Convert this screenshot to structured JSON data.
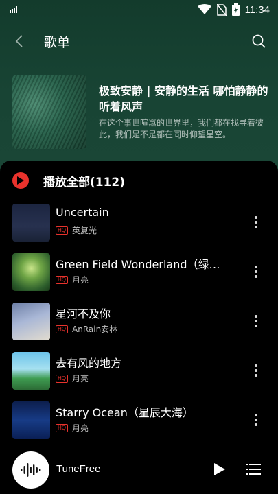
{
  "status_bar": {
    "time": "11:34"
  },
  "appbar": {
    "title": "歌单"
  },
  "playlist": {
    "title": "极致安静 | 安静的生活 哪怕静静的听着风声",
    "description": "在这个事世喧嚣的世界里，我们都在找寻着彼此，我们是不是都在同时仰望星空。"
  },
  "play_all": {
    "label": "播放全部(112)"
  },
  "songs": [
    {
      "title": "Uncertain",
      "quality": "HQ",
      "artist": "英复光"
    },
    {
      "title": "Green Field Wonderland（绿…",
      "quality": "HQ",
      "artist": "月亮"
    },
    {
      "title": "星河不及你",
      "quality": "HQ",
      "artist": "AnRain安林"
    },
    {
      "title": "去有风的地方",
      "quality": "HQ",
      "artist": "月亮"
    },
    {
      "title": "Starry Ocean（星辰大海）",
      "quality": "HQ",
      "artist": "月亮"
    }
  ],
  "player": {
    "title": "TuneFree"
  },
  "colors": {
    "accent": "#e8322c",
    "header_bg": "#184434",
    "background": "#000000"
  }
}
